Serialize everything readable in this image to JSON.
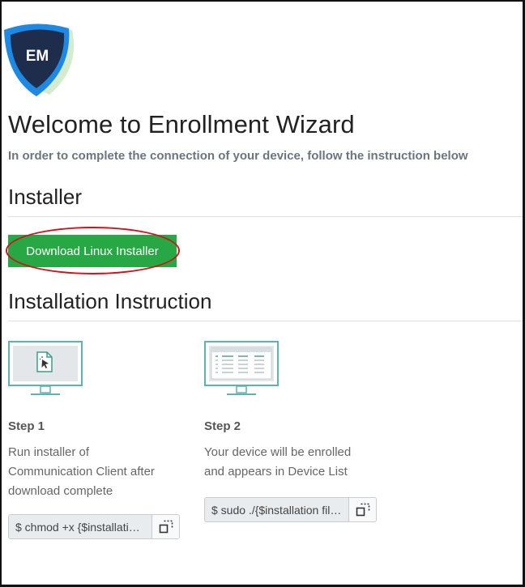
{
  "logo": {
    "text": "EM",
    "colors": {
      "outer": "#1e88e5",
      "inner": "#1f2d4d",
      "accent": "#7fc96b"
    }
  },
  "header": {
    "title": "Welcome to Enrollment Wizard",
    "subtitle": "In order to complete the connection of your device, follow the instruction below"
  },
  "installer": {
    "heading": "Installer",
    "download_label": "Download Linux Installer"
  },
  "instruction": {
    "heading": "Installation Instruction",
    "steps": [
      {
        "title": "Step 1",
        "lines": [
          "Run installer of",
          "Communication Client after",
          "download complete"
        ],
        "command": "$ chmod +x {$installation file name}"
      },
      {
        "title": "Step 2",
        "lines": [
          "Your device will be enrolled",
          "and appears in Device List"
        ],
        "command": "$ sudo ./{$installation file name}"
      }
    ]
  },
  "colors": {
    "primary_button": "#28a745",
    "highlight": "#d0121b"
  }
}
